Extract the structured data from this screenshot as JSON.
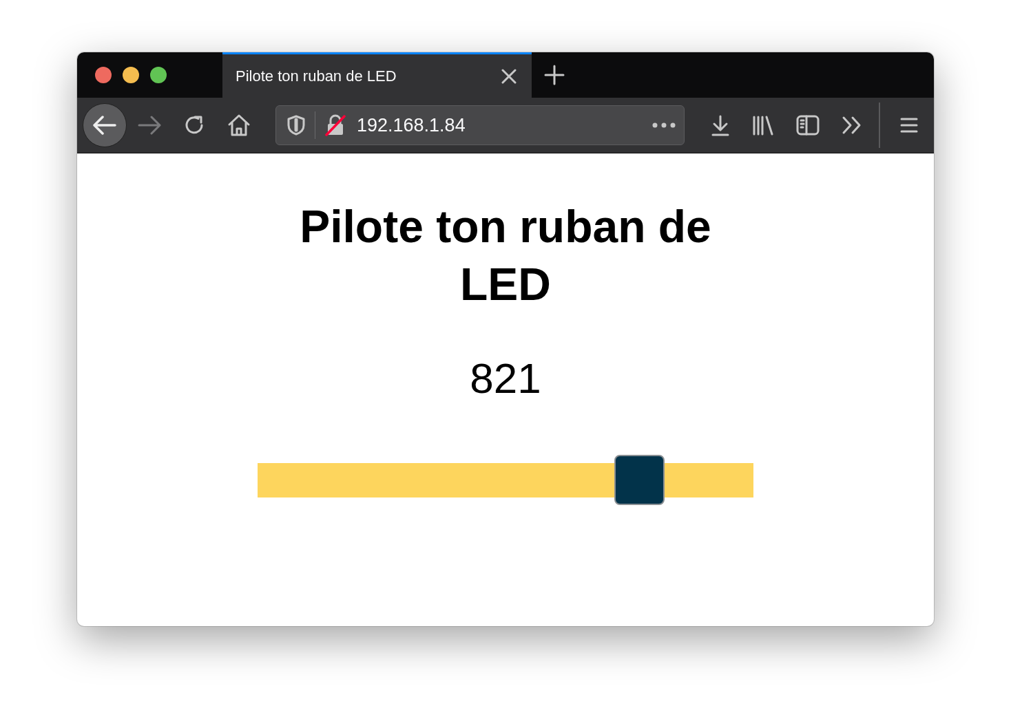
{
  "tabs": [
    {
      "title": "Pilote ton ruban de LED",
      "selected": true
    }
  ],
  "address_bar": {
    "url": "192.168.1.84"
  },
  "page": {
    "heading": "Pilote ton ruban de LED",
    "value": "821",
    "slider": {
      "level": 0.8
    }
  }
}
